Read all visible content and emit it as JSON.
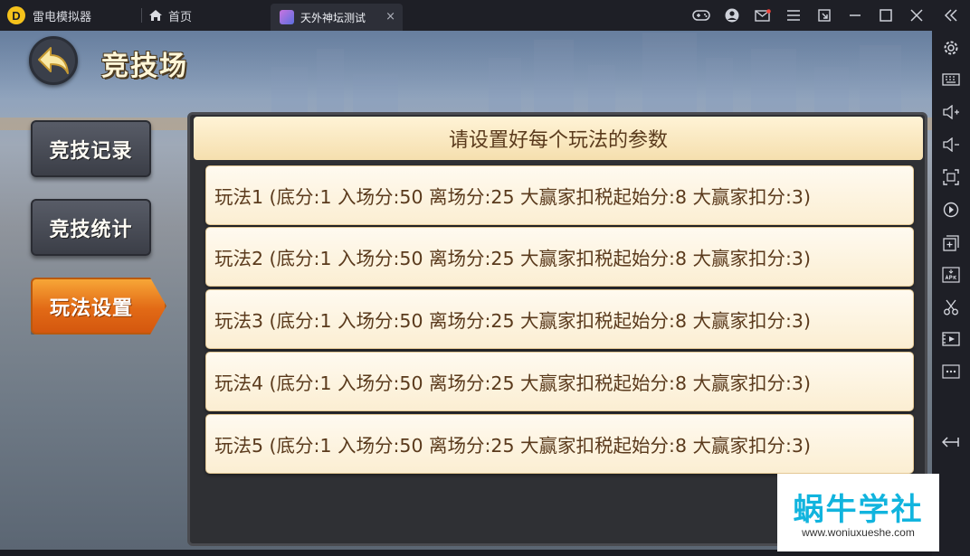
{
  "titlebar": {
    "app_name": "雷电模拟器",
    "home_tab": "首页",
    "game_tab": "天外神坛测试",
    "close_tab_glyph": "×"
  },
  "game": {
    "title": "竞技场",
    "side_tabs": [
      {
        "label": "竞技记录",
        "active": false
      },
      {
        "label": "竞技统计",
        "active": false
      },
      {
        "label": "玩法设置",
        "active": true
      }
    ],
    "panel_title": "请设置好每个玩法的参数",
    "rules": [
      "玩法1 (底分:1 入场分:50 离场分:25 大赢家扣税起始分:8 大赢家扣分:3)",
      "玩法2 (底分:1 入场分:50 离场分:25 大赢家扣税起始分:8 大赢家扣分:3)",
      "玩法3 (底分:1 入场分:50 离场分:25 大赢家扣税起始分:8 大赢家扣分:3)",
      "玩法4 (底分:1 入场分:50 离场分:25 大赢家扣税起始分:8 大赢家扣分:3)",
      "玩法5 (底分:1 入场分:50 离场分:25 大赢家扣税起始分:8 大赢家扣分:3)"
    ]
  },
  "watermark": {
    "main": "蜗牛学社",
    "sub": "www.woniuxueshe.com"
  },
  "icons": {
    "titlebar": [
      "gamepad-icon",
      "account-icon",
      "mail-icon",
      "menu-icon",
      "minimize-to-corner-icon",
      "minimize-icon",
      "maximize-icon",
      "close-icon",
      "collapse-icon"
    ],
    "sidebar": [
      "settings-icon",
      "keyboard-icon",
      "volume-up-icon",
      "volume-down-icon",
      "screenshot-icon",
      "rotate-icon",
      "multi-instance-icon",
      "apk-install-icon",
      "scissors-icon",
      "video-record-icon",
      "more-icon",
      "back-icon"
    ]
  },
  "colors": {
    "active_tab": "#e26a16",
    "panel_text": "#5a3a1c",
    "watermark": "#11b4de"
  }
}
